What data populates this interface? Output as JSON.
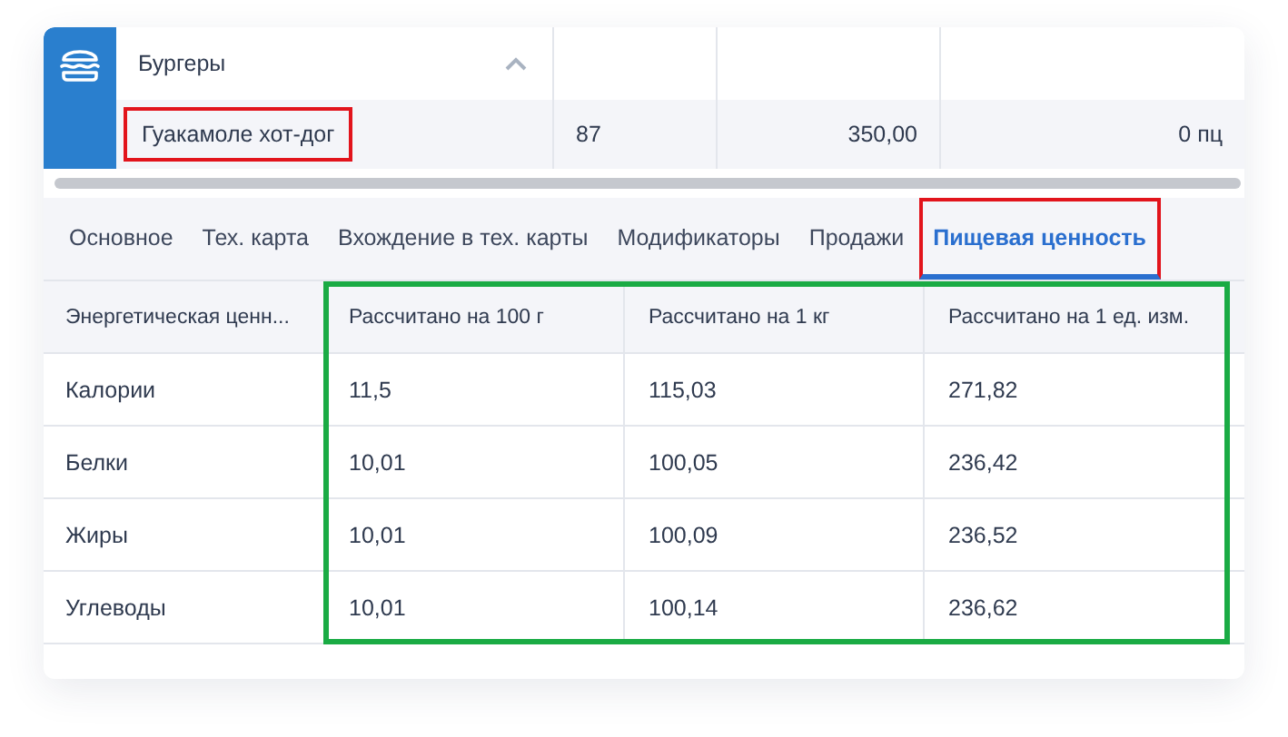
{
  "category": {
    "name": "Бургеры",
    "expanded": true
  },
  "product": {
    "name": "Гуакамоле хот-дог",
    "highlighted": true,
    "cells": [
      "87",
      "350,00",
      "0 пц"
    ]
  },
  "tabs": [
    {
      "label": "Основное",
      "selected": false,
      "highlighted": false
    },
    {
      "label": "Тех. карта",
      "selected": false,
      "highlighted": false
    },
    {
      "label": "Вхождение в тех. карты",
      "selected": false,
      "highlighted": false
    },
    {
      "label": "Модификаторы",
      "selected": false,
      "highlighted": false
    },
    {
      "label": "Продажи",
      "selected": false,
      "highlighted": false
    },
    {
      "label": "Пищевая ценность",
      "selected": true,
      "highlighted": true
    }
  ],
  "table": {
    "columns": [
      {
        "label": "Энергетическая ценн...",
        "highlighted": false
      },
      {
        "label": "Рассчитано на 100 г",
        "highlighted": true
      },
      {
        "label": "Рассчитано на 1 кг",
        "highlighted": true
      },
      {
        "label": "Рассчитано на 1 ед. изм.",
        "highlighted": true
      }
    ],
    "rows": [
      [
        "Калории",
        "11,5",
        "115,03",
        "271,82"
      ],
      [
        "Белки",
        "10,01",
        "100,05",
        "236,42"
      ],
      [
        "Жиры",
        "10,01",
        "100,09",
        "236,52"
      ],
      [
        "Углеводы",
        "10,01",
        "100,14",
        "236,62"
      ]
    ]
  }
}
